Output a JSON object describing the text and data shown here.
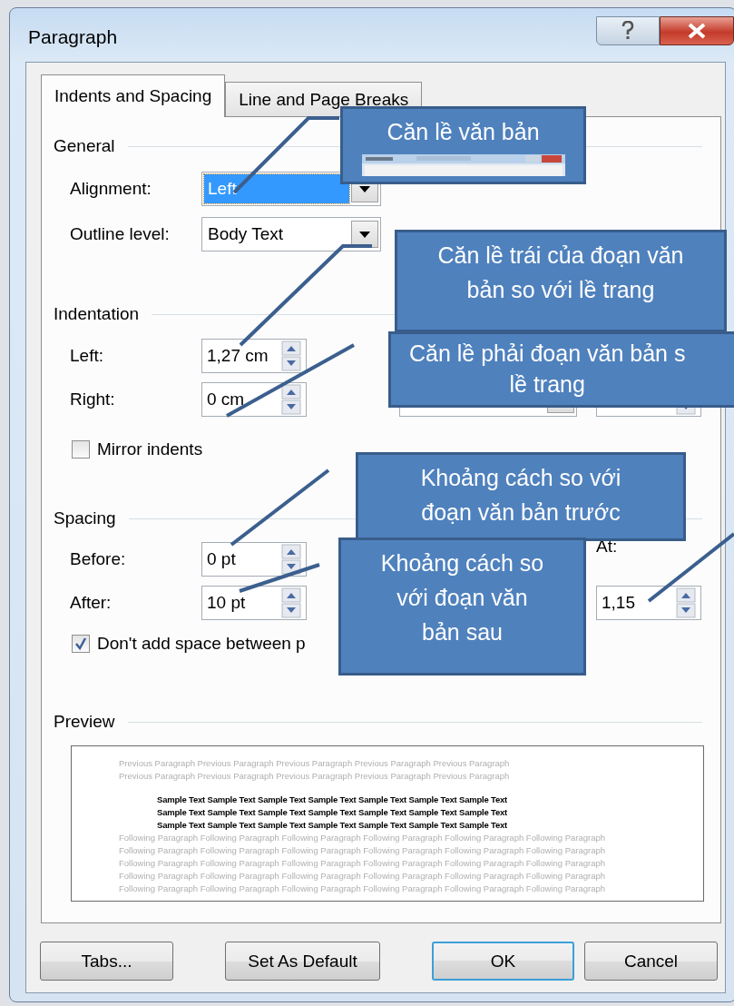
{
  "window": {
    "title": "Paragraph"
  },
  "tabs": [
    {
      "label": "Indents and Spacing",
      "selected": true
    },
    {
      "label": "Line and Page Breaks",
      "selected": false
    }
  ],
  "general": {
    "heading": "General",
    "alignment": {
      "label": "Alignment:",
      "value": "Left",
      "highlighted": true
    },
    "outline_level": {
      "label": "Outline level:",
      "value": "Body Text"
    }
  },
  "indentation": {
    "heading": "Indentation",
    "left": {
      "label": "Left:",
      "value": "1,27 cm"
    },
    "right": {
      "label": "Right:",
      "value": "0 cm"
    },
    "mirror_indents": {
      "label": "Mirror indents",
      "checked": false
    }
  },
  "spacing": {
    "heading": "Spacing",
    "before": {
      "label": "Before:",
      "value": "0 pt"
    },
    "after": {
      "label": "After:",
      "value": "10 pt"
    },
    "at": {
      "label": "At:",
      "value": "1,15"
    },
    "dont_add_space": {
      "label": "Don't add space between p",
      "checked": true
    }
  },
  "preview": {
    "heading": "Preview",
    "previous_lines": [
      "Previous Paragraph Previous Paragraph Previous Paragraph Previous Paragraph Previous Paragraph",
      "Previous Paragraph Previous Paragraph Previous Paragraph Previous Paragraph Previous Paragraph"
    ],
    "sample_lines": [
      "Sample Text Sample Text Sample Text Sample Text Sample Text Sample Text Sample Text",
      "Sample Text Sample Text Sample Text Sample Text Sample Text Sample Text Sample Text",
      "Sample Text Sample Text Sample Text Sample Text Sample Text Sample Text Sample Text"
    ],
    "following_lines": [
      "Following Paragraph Following Paragraph Following Paragraph Following Paragraph Following Paragraph Following Paragraph",
      "Following Paragraph Following Paragraph Following Paragraph Following Paragraph Following Paragraph Following Paragraph",
      "Following Paragraph Following Paragraph Following Paragraph Following Paragraph Following Paragraph Following Paragraph",
      "Following Paragraph Following Paragraph Following Paragraph Following Paragraph Following Paragraph Following Paragraph",
      "Following Paragraph Following Paragraph Following Paragraph Following Paragraph Following Paragraph Following Paragraph"
    ]
  },
  "buttons": [
    {
      "label": "Tabs...",
      "default": false
    },
    {
      "label": "Set As Default",
      "default": false
    },
    {
      "label": "OK",
      "default": true
    },
    {
      "label": "Cancel",
      "default": false
    }
  ],
  "callouts": [
    {
      "lines": [
        "Căn lề văn bản"
      ],
      "kind": "with_picture"
    },
    {
      "lines": [
        "Căn lề trái của đoạn văn",
        "bản so với lề trang"
      ],
      "kind": "text"
    },
    {
      "lines": [
        "Căn lề phải đoạn văn bản s",
        "lề trang"
      ],
      "kind": "text"
    },
    {
      "lines": [
        "Khoảng cách so với",
        "đoạn văn bản trước"
      ],
      "kind": "text"
    },
    {
      "lines": [
        "Khoảng cách so",
        "với đoạn văn",
        "bản sau"
      ],
      "kind": "text"
    }
  ]
}
